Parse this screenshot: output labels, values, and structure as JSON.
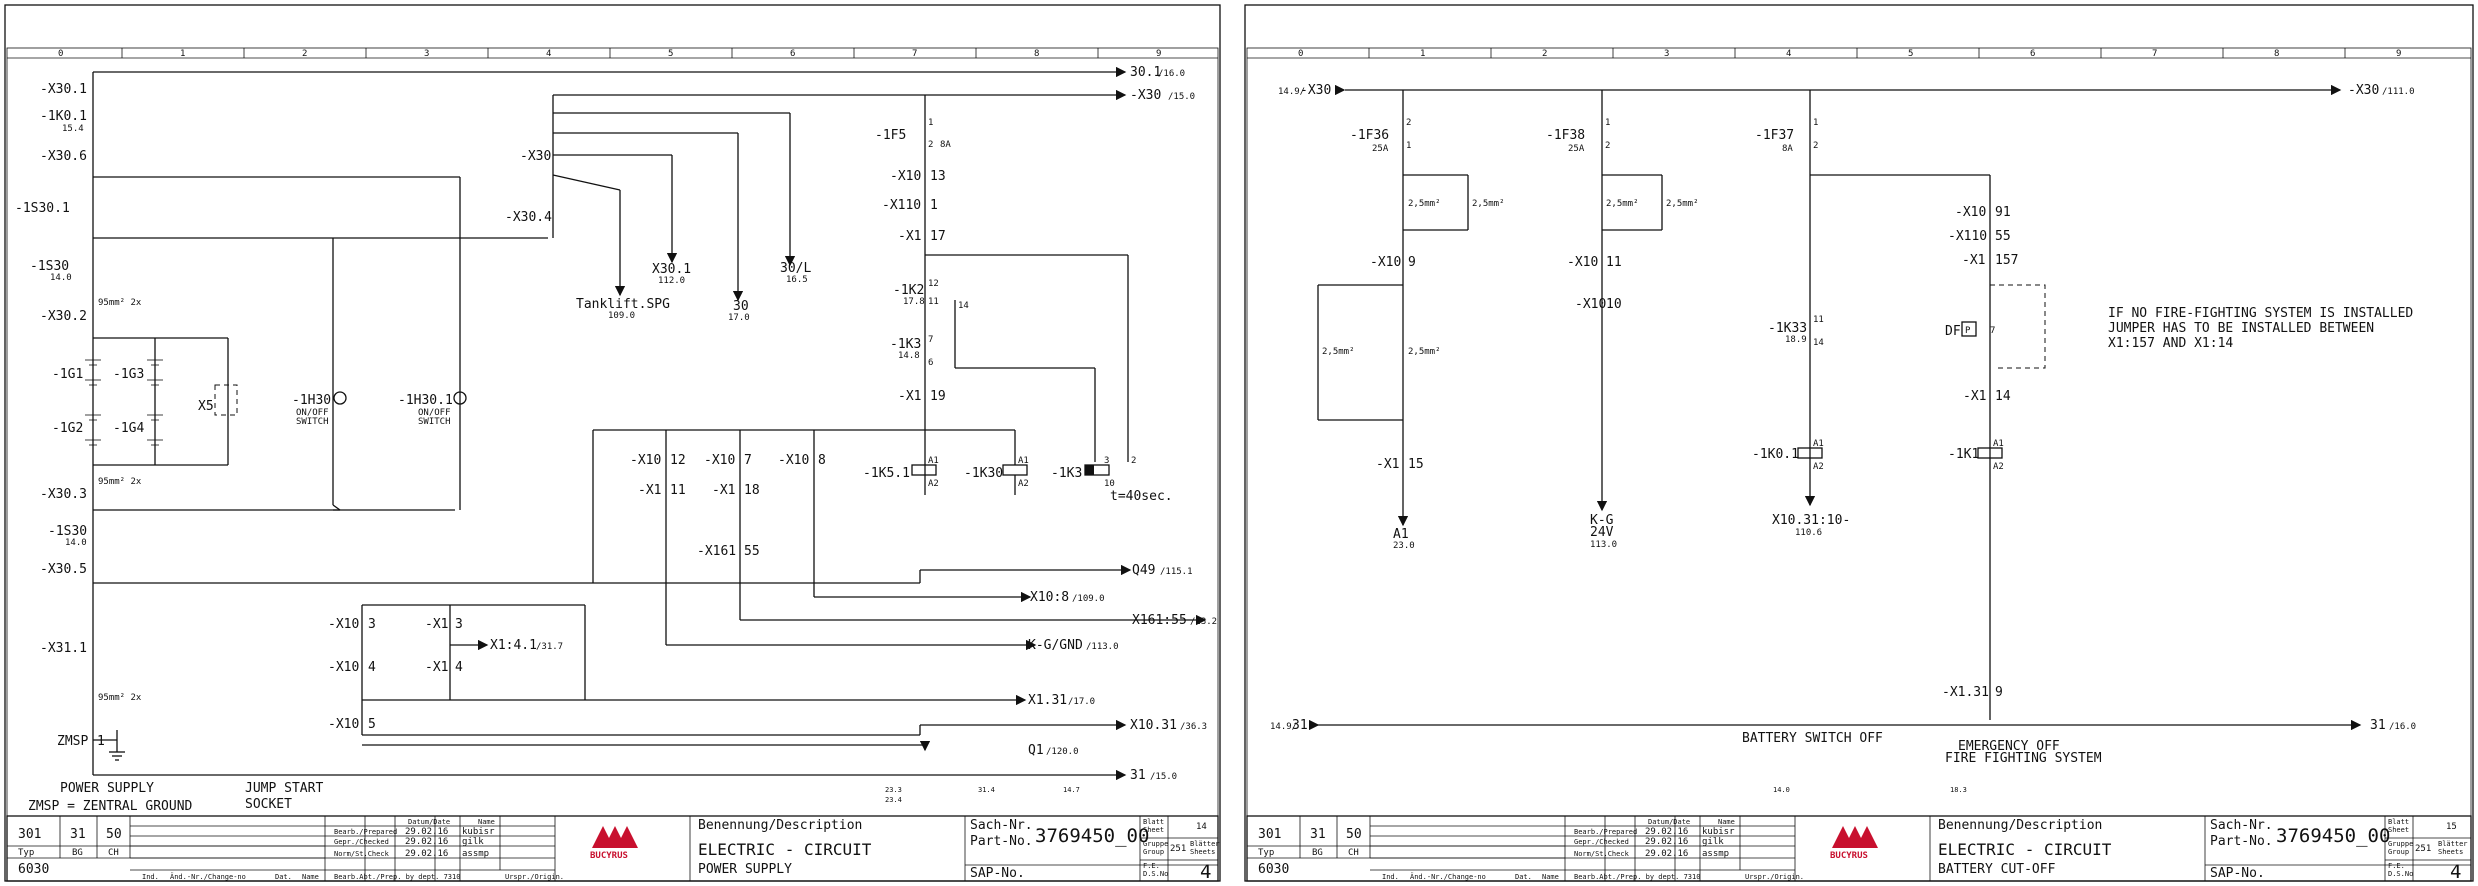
{
  "columns": [
    "0",
    "1",
    "2",
    "3",
    "4",
    "5",
    "6",
    "7",
    "8",
    "9"
  ],
  "colors": {
    "line": "#111111",
    "logo_red": "#c8102e",
    "background": "#ffffff"
  },
  "sheet1": {
    "terminals": {
      "x301": "-X30.1",
      "k01": "-1K0.1",
      "k01_ref": "15.4",
      "x306": "-X30.6",
      "s301": "-1S30.1",
      "s30": "-1S30",
      "s30_ref": "14.0",
      "x302": "-X30.2",
      "g1": "-1G1",
      "g2": "-1G2",
      "g3": "-1G3",
      "g4": "-1G4",
      "x5": "X5",
      "h30": "-1H30",
      "h30_sub1": "ON/OFF",
      "h30_sub2": "SWITCH",
      "h301": "-1H30.1",
      "h301_sub1": "ON/OFF",
      "h301_sub2": "SWITCH",
      "x303": "-X30.3",
      "s30b": "-1S30",
      "s30b_ref": "14.0",
      "x305": "-X30.5",
      "x311": "-X31.1",
      "zmsp": "ZMSP",
      "zmsp_n": "1",
      "x30": "-X30",
      "x304": "-X30.4",
      "f5": "-1F5",
      "f5_amp": "8A",
      "x10_13": "-X10",
      "x10_13n": "13",
      "x110_1": "-X110",
      "x110_1n": "1",
      "x1_17": "-X1",
      "x1_17n": "17",
      "k2": "-1K2",
      "k2_ref": "17.8",
      "k3": "-1K3",
      "k3_ref": "14.8",
      "x1_19": "-X1",
      "x1_19n": "19",
      "x10_12": "-X10",
      "x10_12n": "12",
      "x1_11": "-X1",
      "x1_11n": "11",
      "x10_7": "-X10",
      "x10_7n": "7",
      "x10_8": "-X10",
      "x10_8n": "8",
      "x1_18": "-X1",
      "x1_18n": "18",
      "x161_55": "-X161",
      "x161_55n": "55",
      "k51": "-1K5.1",
      "k30": "-1K30",
      "k3b": "-1K3",
      "timer": "t=40sec.",
      "x10_3": "-X10",
      "x10_3n": "3",
      "x1_3": "-X1",
      "x1_3n": "3",
      "x10_4": "-X10",
      "x10_4n": "4",
      "x1_4": "-X1",
      "x1_4n": "4",
      "x10_5": "-X10",
      "x10_5n": "5",
      "cable1": "95mm² 2x",
      "cable2": "95mm² 2x",
      "cable3": "95mm² 2x",
      "num1": "1",
      "num2": "2",
      "num3": "3",
      "num4": "4",
      "num11": "11",
      "num12": "12",
      "num14": "14",
      "num7": "7",
      "num6": "6",
      "numA1": "A1",
      "numA2": "A2",
      "num10": "10"
    },
    "destinations": {
      "d301": "30.1",
      "d301_ref": "/16.0",
      "dx30": "-X30",
      "dx30_ref": "/15.0",
      "tank": "Tanklift.SPG",
      "tank_ref": "109.0",
      "x301b": "X30.1",
      "x301b_ref": "112.0",
      "d30": "30",
      "d30_ref": "17.0",
      "d30l": "30/L",
      "d30l_ref": "16.5",
      "q49": "Q49",
      "q49_ref": "/115.1",
      "x108": "X10:8",
      "x108_ref": "/109.0",
      "x16155": "X161:55",
      "x16155_ref": "/23.2",
      "kg": "K-G/GND",
      "kg_ref": "/113.0",
      "x1314": "X1:4.1",
      "x1314_ref": "/31.7",
      "x131": "X1.31",
      "x131_ref": "/17.0",
      "x1031": "X10.31",
      "x1031_ref": "/36.3",
      "q1": "Q1",
      "q1_ref": "/120.0",
      "d31": "31",
      "d31_ref": "/15.0"
    },
    "footer_labels": {
      "power": "POWER SUPPLY",
      "zmsp": "ZMSP = ZENTRAL GROUND",
      "jump1": "JUMP START",
      "jump2": "SOCKET"
    },
    "contact_refs": [
      "23.3",
      "23.4",
      "31.4",
      "14.7"
    ],
    "title_block": {
      "c1": "301",
      "c2": "31",
      "c3": "50",
      "typ": "Typ",
      "bg": "BG",
      "ch": "CH",
      "code": "6030",
      "date_hdr": "Datum/Date",
      "name_hdr": "Name",
      "row1_lbl": "Bearb./Prepared",
      "row1_date": "29.02.16",
      "row1_name": "kubisr",
      "row2_lbl": "Gepr./Checked",
      "row2_date": "29.02.16",
      "row2_name": "gilk",
      "row3_lbl": "Norm/St.Check",
      "row3_date": "29.02.16",
      "row3_name": "assmp",
      "ind": "Ind.",
      "change": "Änd.-Nr./Change-no",
      "dat": "Dat.",
      "nam": "Name",
      "dept": "Bearb.Abt./Prep. by dept. 7310",
      "origin": "Urspr./Origin.",
      "logo": "BUCYRUS",
      "desc_lbl": "Benennung/Description",
      "title": "ELECTRIC - CIRCUIT",
      "subtitle": "POWER SUPPLY",
      "sach": "Sach-Nr.",
      "part": "Part-No.",
      "part_no": "3769450_00",
      "sap": "SAP-No.",
      "blatt": "Blatt",
      "sheet": "Sheet",
      "sheet_no": "14",
      "gruppe": "Gruppe",
      "group": "Group",
      "group_no": "251",
      "blaetter": "Blätter",
      "sheets": "Sheets",
      "fe": "F.E.",
      "ds": "D.S.No",
      "rev": "4"
    }
  },
  "sheet2": {
    "terminals": {
      "left_ref": "14.9/",
      "left_x30": "-X30",
      "right_x30": "-X30",
      "right_x30_ref": "/111.0",
      "f36": "-1F36",
      "f36_amp": "25A",
      "f38": "-1F38",
      "f38_amp": "25A",
      "f37": "-1F37",
      "f37_amp": "8A",
      "w1": "2,5mm²",
      "w2": "2,5mm²",
      "w3": "2,5mm²",
      "w4": "2,5mm²",
      "w5": "2,5mm²",
      "w6": "2,5mm²",
      "x10_9": "-X10",
      "x10_9n": "9",
      "x10_11": "-X10",
      "x10_11n": "11",
      "x10_10": "-X10",
      "x10_10n": "10",
      "x1_15": "-X1",
      "x1_15n": "15",
      "x10_91": "-X10",
      "x10_91n": "91",
      "x110_55": "-X110",
      "x110_55n": "55",
      "x1_157": "-X1",
      "x1_157n": "157",
      "k33": "-1K33",
      "k33_ref": "18.9",
      "df": "DF",
      "p": "P",
      "x1_14": "-X1",
      "x1_14n": "14",
      "k01": "-1K0.1",
      "k1": "-1K1",
      "x131_9": "-X1.31",
      "x131_9n": "9",
      "n1": "1",
      "n2": "2",
      "n11": "11",
      "n14": "14",
      "n7": "7",
      "nA1": "A1",
      "nA2": "A2",
      "bot_left": "14.9/",
      "bot_31": "31",
      "bot_right": "31",
      "bot_right_ref": "/16.0"
    },
    "destinations": {
      "a1": "A1",
      "a1_ref": "23.0",
      "kg": "K-G",
      "kg_v": "24V",
      "kg_ref": "113.0",
      "x1031": "X10.31:10-",
      "x1031_ref": "110.6"
    },
    "note": [
      "IF NO FIRE-FIGHTING SYSTEM IS INSTALLED",
      "JUMPER HAS TO BE INSTALLED BETWEEN",
      "X1:157 AND X1:14"
    ],
    "footer_labels": {
      "battery": "BATTERY SWITCH OFF",
      "emergency1": "EMERGENCY OFF",
      "emergency2": "FIRE FIGHTING SYSTEM",
      "ref1": "14.0",
      "ref2": "18.3"
    },
    "title_block": {
      "c1": "301",
      "c2": "31",
      "c3": "50",
      "typ": "Typ",
      "bg": "BG",
      "ch": "CH",
      "code": "6030",
      "date_hdr": "Datum/Date",
      "name_hdr": "Name",
      "row1_lbl": "Bearb./Prepared",
      "row1_date": "29.02.16",
      "row1_name": "kubisr",
      "row2_lbl": "Gepr./Checked",
      "row2_date": "29.02.16",
      "row2_name": "gilk",
      "row3_lbl": "Norm/St.Check",
      "row3_date": "29.02.16",
      "row3_name": "assmp",
      "ind": "Ind.",
      "change": "Änd.-Nr./Change-no",
      "dat": "Dat.",
      "nam": "Name",
      "dept": "Bearb.Abt./Prep. by dept. 7310",
      "origin": "Urspr./Origin.",
      "logo": "BUCYRUS",
      "desc_lbl": "Benennung/Description",
      "title": "ELECTRIC - CIRCUIT",
      "subtitle": "BATTERY CUT-OFF",
      "sach": "Sach-Nr.",
      "part": "Part-No.",
      "part_no": "3769450_00",
      "sap": "SAP-No.",
      "blatt": "Blatt",
      "sheet": "Sheet",
      "sheet_no": "15",
      "gruppe": "Gruppe",
      "group": "Group",
      "group_no": "251",
      "blaetter": "Blätter",
      "sheets": "Sheets",
      "fe": "F.E.",
      "ds": "D.S.No",
      "rev": "4"
    }
  }
}
